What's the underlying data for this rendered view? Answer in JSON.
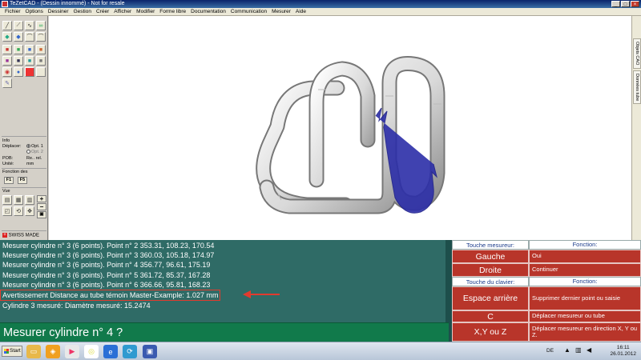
{
  "window": {
    "title": "TeZetCAD - (Dessin innommé) - Not for resale"
  },
  "menu": [
    "Fichier",
    "Options",
    "Dessiner",
    "Gestion",
    "Créer",
    "Afficher",
    "Modifier",
    "Forme libre",
    "Documentation",
    "Communication",
    "Mesurer",
    "Aide"
  ],
  "left_panel": {
    "info_label": "Info",
    "deplacer_label": "Déplacer:",
    "opt1": "Opt. 1",
    "opt2": "Opt. 2",
    "pob_label": "POB:",
    "pob_value": "Re.. rel.",
    "unite_label": "Unité:",
    "unite_value": "mm",
    "fonction_label": "Fonction des",
    "f1": "F1",
    "f5": "F5",
    "vue_label": "Vue",
    "zoom_in": "+",
    "zoom_out": "−",
    "swiss": "SWISS MADE"
  },
  "side_tabs": [
    "Objets CAO",
    "Données tube"
  ],
  "log": {
    "lines": [
      "Mesurer cylindre n° 3 (6 points). Point n° 2  353.31, 108.23, 170.54",
      "Mesurer cylindre n° 3 (6 points). Point n° 3  360.03, 105.18, 174.97",
      "Mesurer cylindre n° 3 (6 points). Point n° 4  356.77, 96.61, 175.19",
      "Mesurer cylindre n° 3 (6 points). Point n° 5  361.72, 85.37, 167.28",
      "Mesurer cylindre n° 3 (6 points). Point n° 6  366.66, 95.81, 168.23"
    ],
    "highlight": "Avertissement Distance au tube témoin Master-Example: 1.027 mm",
    "last": "Cylindre 3 mesuré: Diamètre mesuré: 15.2474"
  },
  "prompt": "Mesurer cylindre n° 4 ?",
  "keys": {
    "header1_key": "Touche mesureur:",
    "header1_func": "Fonction:",
    "gauche": "Gauche",
    "gauche_func": "Oui",
    "droite": "Droite",
    "droite_func": "Continuer",
    "header2_key": "Touche du clavier:",
    "header2_func": "Fonction:",
    "backspace": "Espace arrière",
    "backspace_func": "Supprimer dernier point ou saisie",
    "c": "C",
    "c_func": "Déplacer mesureur ou tube",
    "xyz": "X,Y ou Z",
    "xyz_func": "Déplacer mesureur en direction X, Y ou Z."
  },
  "taskbar": {
    "start": "Start",
    "lang": "DE",
    "time": "16:11",
    "date": "26.01.2012"
  },
  "colors": {
    "log_bg": "#2f6b66",
    "prompt_bg": "#117a4b",
    "key_red": "#b8352a",
    "tube_blue": "#2c2ea8",
    "highlight": "#e23b2e"
  }
}
